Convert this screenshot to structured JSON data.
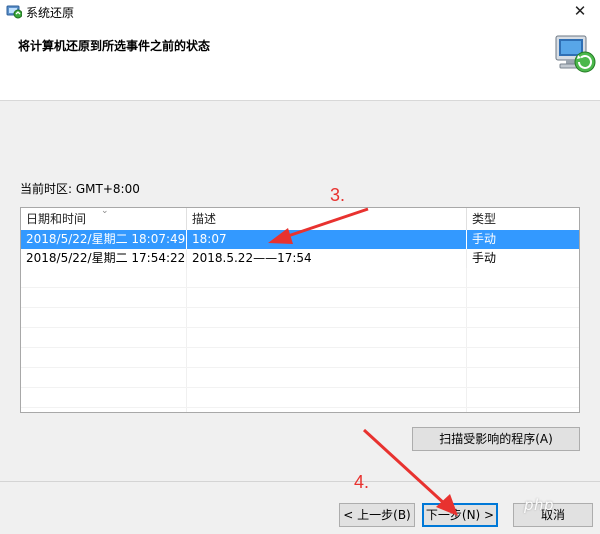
{
  "window": {
    "title": "系统还原",
    "close_glyph": "✕"
  },
  "header": {
    "title": "将计算机还原到所选事件之前的状态"
  },
  "timezone_text": "当前时区: GMT+8:00",
  "table": {
    "columns": [
      "日期和时间",
      "描述",
      "类型"
    ],
    "sort_glyph": "⌄",
    "rows": [
      {
        "date": "2018/5/22/星期二 18:07:49",
        "desc": "18:07",
        "type": "手动",
        "selected": true
      },
      {
        "date": "2018/5/22/星期二 17:54:22",
        "desc": "2018.5.22——17:54",
        "type": "手动",
        "selected": false
      }
    ]
  },
  "buttons": {
    "scan": "扫描受影响的程序(A)",
    "back": "< 上一步(B)",
    "next": "下一步(N) >",
    "cancel": "取消"
  },
  "annotations": {
    "step3": "3.",
    "step4": "4."
  },
  "watermark": "php",
  "colors": {
    "selection": "#3399ff",
    "annotation": "#e8322f",
    "default_button_border": "#0078d7"
  },
  "icons": {
    "app": "system-restore-icon",
    "header": "computer-restore-icon"
  }
}
